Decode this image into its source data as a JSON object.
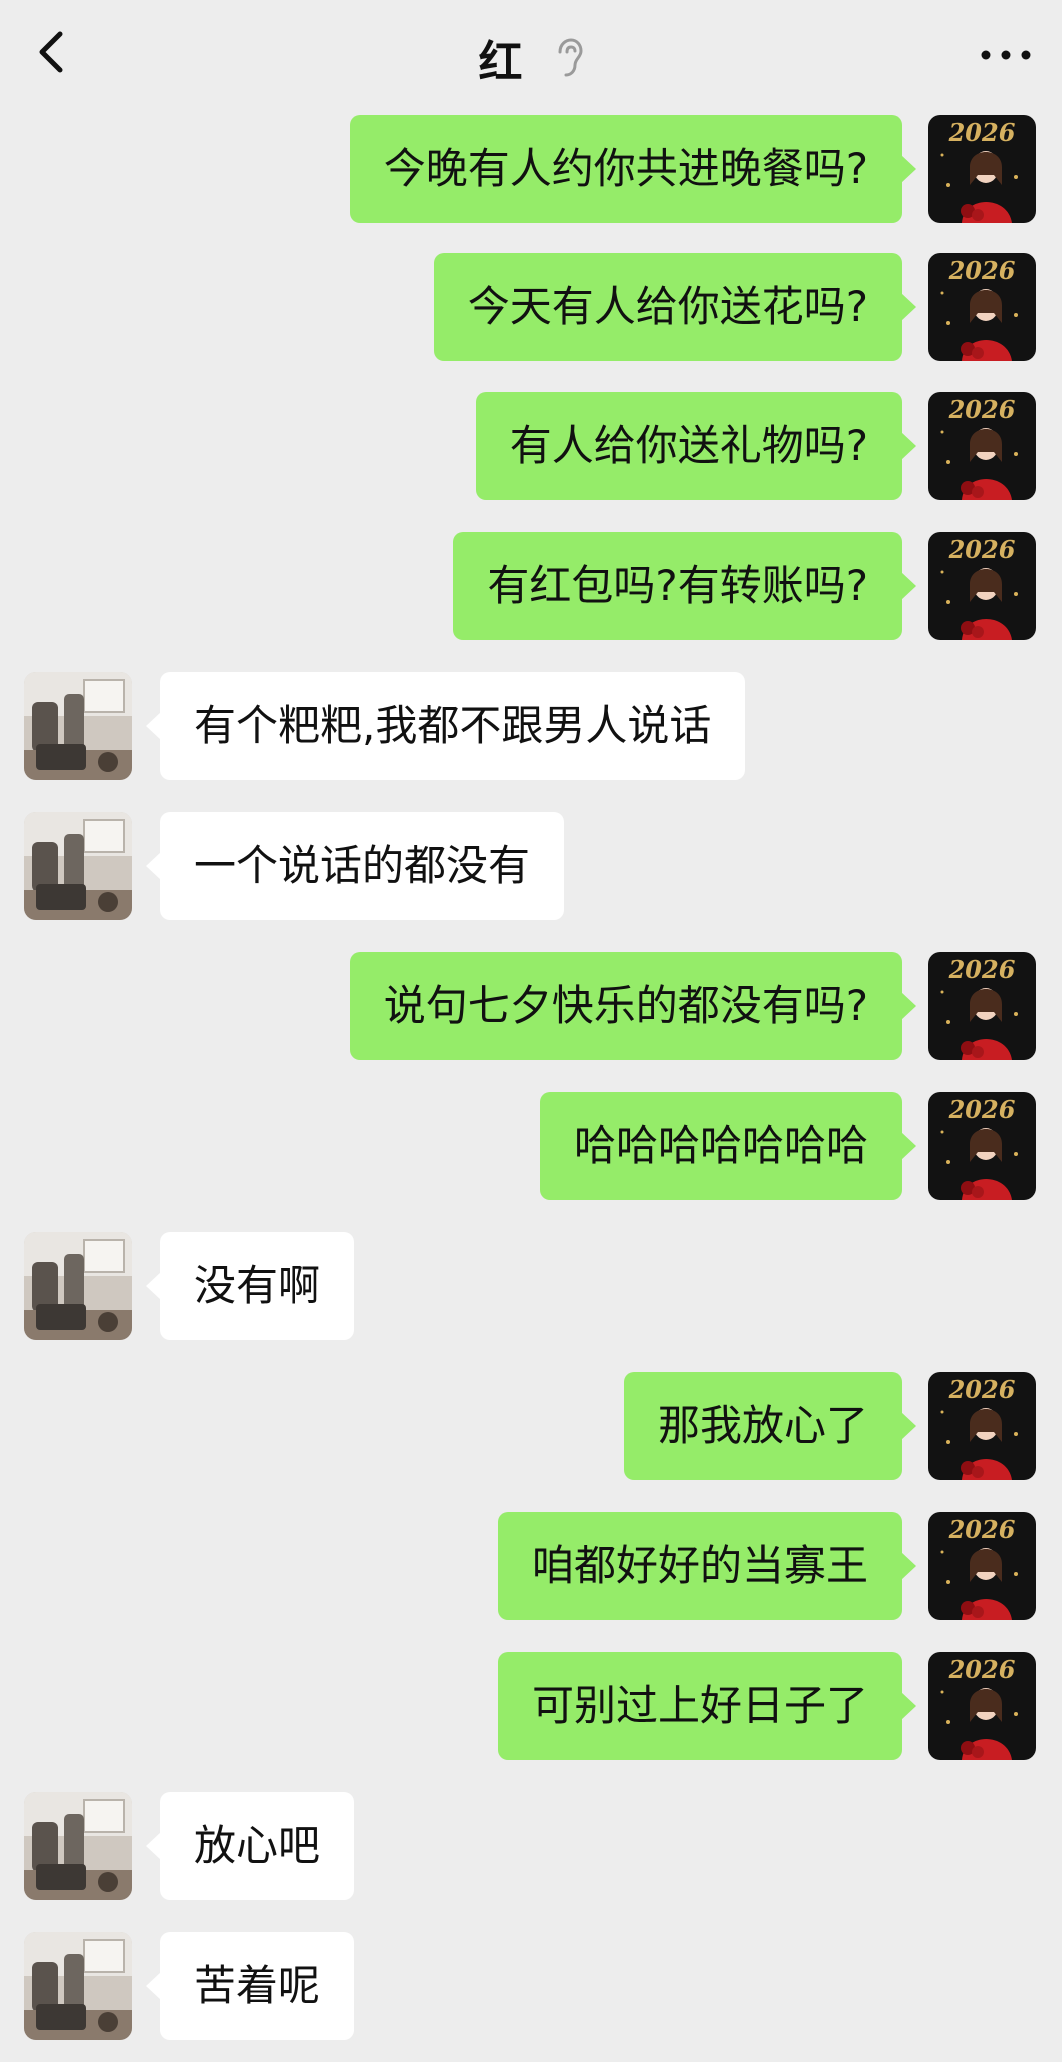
{
  "header": {
    "title": "红",
    "back_icon": "chevron-left-icon",
    "ear_icon": "ear-icon",
    "more_icon": "more-dots-icon"
  },
  "colors": {
    "background": "#ededed",
    "my_bubble": "#95ec69",
    "their_bubble": "#ffffff"
  },
  "avatars": {
    "me": {
      "badge_text": "2026"
    },
    "other": {}
  },
  "messages": [
    {
      "sender": "me",
      "text": "今晚有人约你共进晚餐吗?"
    },
    {
      "sender": "me",
      "text": "今天有人给你送花吗?"
    },
    {
      "sender": "me",
      "text": "有人给你送礼物吗?"
    },
    {
      "sender": "me",
      "text": "有红包吗?有转账吗?"
    },
    {
      "sender": "other",
      "text": "有个粑粑,我都不跟男人说话"
    },
    {
      "sender": "other",
      "text": "一个说话的都没有"
    },
    {
      "sender": "me",
      "text": "说句七夕快乐的都没有吗?"
    },
    {
      "sender": "me",
      "text": "哈哈哈哈哈哈哈"
    },
    {
      "sender": "other",
      "text": "没有啊"
    },
    {
      "sender": "me",
      "text": "那我放心了"
    },
    {
      "sender": "me",
      "text": "咱都好好的当寡王"
    },
    {
      "sender": "me",
      "text": "可别过上好日子了"
    },
    {
      "sender": "other",
      "text": "放心吧"
    },
    {
      "sender": "other",
      "text": "苦着呢"
    }
  ]
}
